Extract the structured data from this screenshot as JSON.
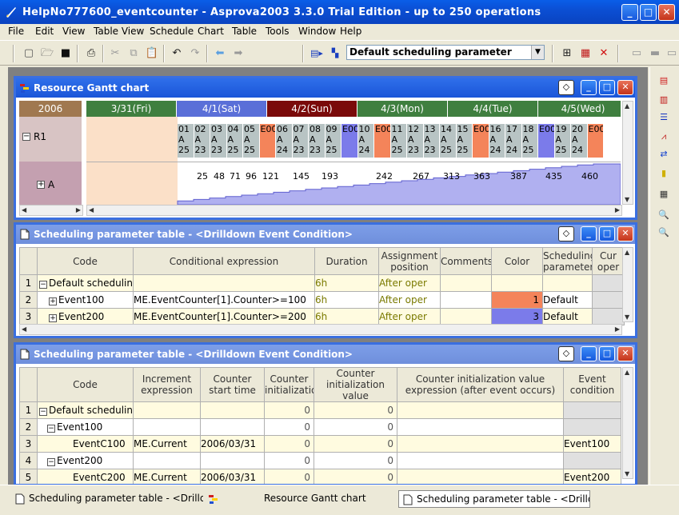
{
  "window": {
    "title": "HelpNo777600_eventcounter - Asprova2003 3.3.0 Trial Edition  - up to 250 operations",
    "min": "_",
    "max": "□",
    "close": "✕"
  },
  "menu": [
    "File",
    "Edit",
    "View",
    "Table View",
    "Schedule",
    "Chart",
    "Table",
    "Tools",
    "Window",
    "Help"
  ],
  "toolbar": {
    "parameter_select": "Default scheduling parameter"
  },
  "gantt": {
    "title": "Resource Gantt chart",
    "year": "2006",
    "resources": [
      "R1",
      "A"
    ],
    "days": [
      {
        "label": "3/31(Fri)",
        "color": "#3f7f3f"
      },
      {
        "label": "4/1(Sat)",
        "color": "#5a6fd8"
      },
      {
        "label": "4/2(Sun)",
        "color": "#7a0a0a"
      },
      {
        "label": "4/3(Mon)",
        "color": "#3f7f3f"
      },
      {
        "label": "4/4(Tue)",
        "color": "#3f7f3f"
      },
      {
        "label": "4/5(Wed)",
        "color": "#3f7f3f"
      }
    ],
    "operations": [
      {
        "l1": "01",
        "l2": "A",
        "l3": "25",
        "c": "#b8c4c4"
      },
      {
        "l1": "02",
        "l2": "A",
        "l3": "23",
        "c": "#b8c4c4"
      },
      {
        "l1": "03",
        "l2": "A",
        "l3": "23",
        "c": "#b8c4c4"
      },
      {
        "l1": "04",
        "l2": "A",
        "l3": "25",
        "c": "#b8c4c4"
      },
      {
        "l1": "05",
        "l2": "A",
        "l3": "25",
        "c": "#b8c4c4"
      },
      {
        "l1": "E000",
        "l2": "",
        "l3": "",
        "c": "#f4845a"
      },
      {
        "l1": "06",
        "l2": "A",
        "l3": "24",
        "c": "#b8c4c4"
      },
      {
        "l1": "07",
        "l2": "A",
        "l3": "23",
        "c": "#b8c4c4"
      },
      {
        "l1": "08",
        "l2": "A",
        "l3": "23",
        "c": "#b8c4c4"
      },
      {
        "l1": "09",
        "l2": "A",
        "l3": "25",
        "c": "#b8c4c4"
      },
      {
        "l1": "E000",
        "l2": "",
        "l3": "",
        "c": "#7b7bea"
      },
      {
        "l1": "10",
        "l2": "A",
        "l3": "24",
        "c": "#b8c4c4"
      },
      {
        "l1": "E000",
        "l2": "",
        "l3": "",
        "c": "#f4845a"
      },
      {
        "l1": "11",
        "l2": "A",
        "l3": "25",
        "c": "#b8c4c4"
      },
      {
        "l1": "12",
        "l2": "A",
        "l3": "23",
        "c": "#b8c4c4"
      },
      {
        "l1": "13",
        "l2": "A",
        "l3": "23",
        "c": "#b8c4c4"
      },
      {
        "l1": "14",
        "l2": "A",
        "l3": "25",
        "c": "#b8c4c4"
      },
      {
        "l1": "15",
        "l2": "A",
        "l3": "25",
        "c": "#b8c4c4"
      },
      {
        "l1": "E000",
        "l2": "",
        "l3": "",
        "c": "#f4845a"
      },
      {
        "l1": "16",
        "l2": "A",
        "l3": "24",
        "c": "#b8c4c4"
      },
      {
        "l1": "17",
        "l2": "A",
        "l3": "24",
        "c": "#b8c4c4"
      },
      {
        "l1": "18",
        "l2": "A",
        "l3": "25",
        "c": "#b8c4c4"
      },
      {
        "l1": "E000",
        "l2": "",
        "l3": "",
        "c": "#7b7bea"
      },
      {
        "l1": "19",
        "l2": "A",
        "l3": "25",
        "c": "#b8c4c4"
      },
      {
        "l1": "20",
        "l2": "A",
        "l3": "24",
        "c": "#b8c4c4"
      },
      {
        "l1": "E0007",
        "l2": "",
        "l3": "",
        "c": "#f4845a"
      }
    ],
    "counters": [
      "25",
      "48",
      "71",
      "96",
      "121",
      "145",
      "193",
      "242",
      "267",
      "313",
      "363",
      "387",
      "435",
      "460"
    ]
  },
  "table1": {
    "title": "Scheduling parameter table - <Drilldown Event Condition>",
    "headers": [
      "Code",
      "Conditional expression",
      "Duration",
      "Assignment position",
      "Comments",
      "Color",
      "Scheduling parameter",
      "Cur oper"
    ],
    "rows": [
      {
        "n": "1",
        "code": "Default schedulin",
        "expr": "",
        "dur": "6h",
        "pos": "After oper",
        "com": "",
        "color": "",
        "param": ""
      },
      {
        "n": "2",
        "code": "Event100",
        "expr": "ME.EventCounter[1].Counter>=100",
        "dur": "6h",
        "pos": "After oper",
        "com": "",
        "color": "1",
        "param": "Default"
      },
      {
        "n": "3",
        "code": "Event200",
        "expr": "ME.EventCounter[1].Counter>=200",
        "dur": "6h",
        "pos": "After oper",
        "com": "",
        "color": "3",
        "param": "Default"
      }
    ]
  },
  "table2": {
    "title": "Scheduling parameter table - <Drilldown Event Condition>",
    "headers": [
      "Code",
      "Increment expression",
      "Counter start time",
      "Counter initialization",
      "Counter initialization value",
      "Counter initialization value expression (after event occurs)",
      "Event condition"
    ],
    "rows": [
      {
        "n": "1",
        "code": "Default schedulin",
        "inc": "",
        "start": "",
        "init": "0",
        "val": "0",
        "exp": "",
        "ev": ""
      },
      {
        "n": "2",
        "code": "Event100",
        "inc": "",
        "start": "",
        "init": "0",
        "val": "0",
        "exp": "",
        "ev": ""
      },
      {
        "n": "3",
        "code": "EventC100",
        "inc": "ME.Current",
        "start": "2006/03/31",
        "init": "0",
        "val": "0",
        "exp": "",
        "ev": "Event100"
      },
      {
        "n": "4",
        "code": "Event200",
        "inc": "",
        "start": "",
        "init": "0",
        "val": "0",
        "exp": "",
        "ev": ""
      },
      {
        "n": "5",
        "code": "EventC200",
        "inc": "ME.Current",
        "start": "2006/03/31",
        "init": "0",
        "val": "0",
        "exp": "",
        "ev": "Event200"
      }
    ]
  },
  "taskbar": [
    {
      "label": "Scheduling parameter table - <Drilldown ..."
    },
    {
      "label": "Resource Gantt chart"
    },
    {
      "label": "Scheduling parameter table - <Drilldown ..."
    }
  ]
}
